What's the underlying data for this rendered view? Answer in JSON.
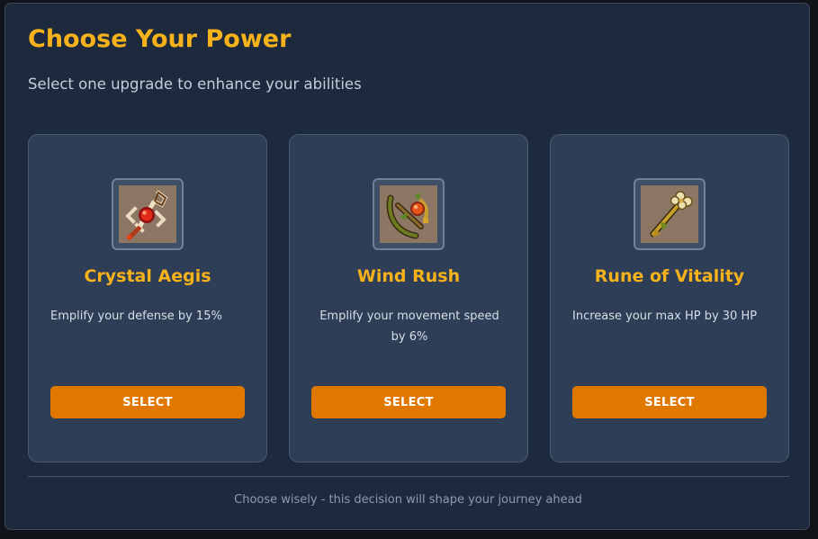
{
  "modal": {
    "title": "Choose Your Power",
    "subtitle": "Select one upgrade to enhance your abilities",
    "footer": "Choose wisely - this decision will shape your journey ahead"
  },
  "cards": [
    {
      "icon": "crystal-aegis-icon",
      "title": "Crystal Aegis",
      "description": "Emplify your defense by 15%",
      "button_label": "SELECT"
    },
    {
      "icon": "wind-rush-icon",
      "title": "Wind Rush",
      "description": "Emplify your movement speed by 6%",
      "button_label": "SELECT"
    },
    {
      "icon": "rune-of-vitality-icon",
      "title": "Rune of Vitality",
      "description": "Increase your max HP by 30 HP",
      "button_label": "SELECT"
    }
  ],
  "colors": {
    "accent": "#f6b21b",
    "button": "#e07800",
    "panel": "#1d2a3d",
    "card": "#2e3e56"
  }
}
